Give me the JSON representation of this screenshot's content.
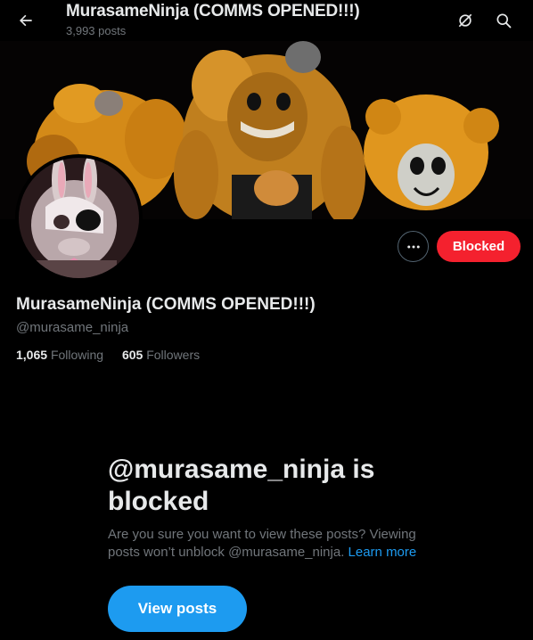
{
  "header": {
    "title": "MurasameNinja (COMMS OPENED!!!)",
    "post_count": "3,993 posts",
    "back_icon": "back-arrow-icon",
    "icons": [
      "grok-icon",
      "search-icon"
    ]
  },
  "profile": {
    "display_name": "MurasameNinja (COMMS OPENED!!!)",
    "handle": "@murasame_ninja",
    "following_count": "1,065",
    "following_label": "Following",
    "followers_count": "605",
    "followers_label": "Followers",
    "blocked_label": "Blocked"
  },
  "blocked_notice": {
    "title": "@murasame_ninja is blocked",
    "description": "Are you sure you want to view these posts? Viewing posts won’t unblock @murasame_ninja.",
    "learn_more": "Learn more",
    "view_button": "View posts"
  },
  "colors": {
    "background": "#000000",
    "primary_text": "#e7e9ea",
    "secondary_text": "#71767b",
    "accent": "#1d9bf0",
    "blocked_red": "#f4212e"
  }
}
